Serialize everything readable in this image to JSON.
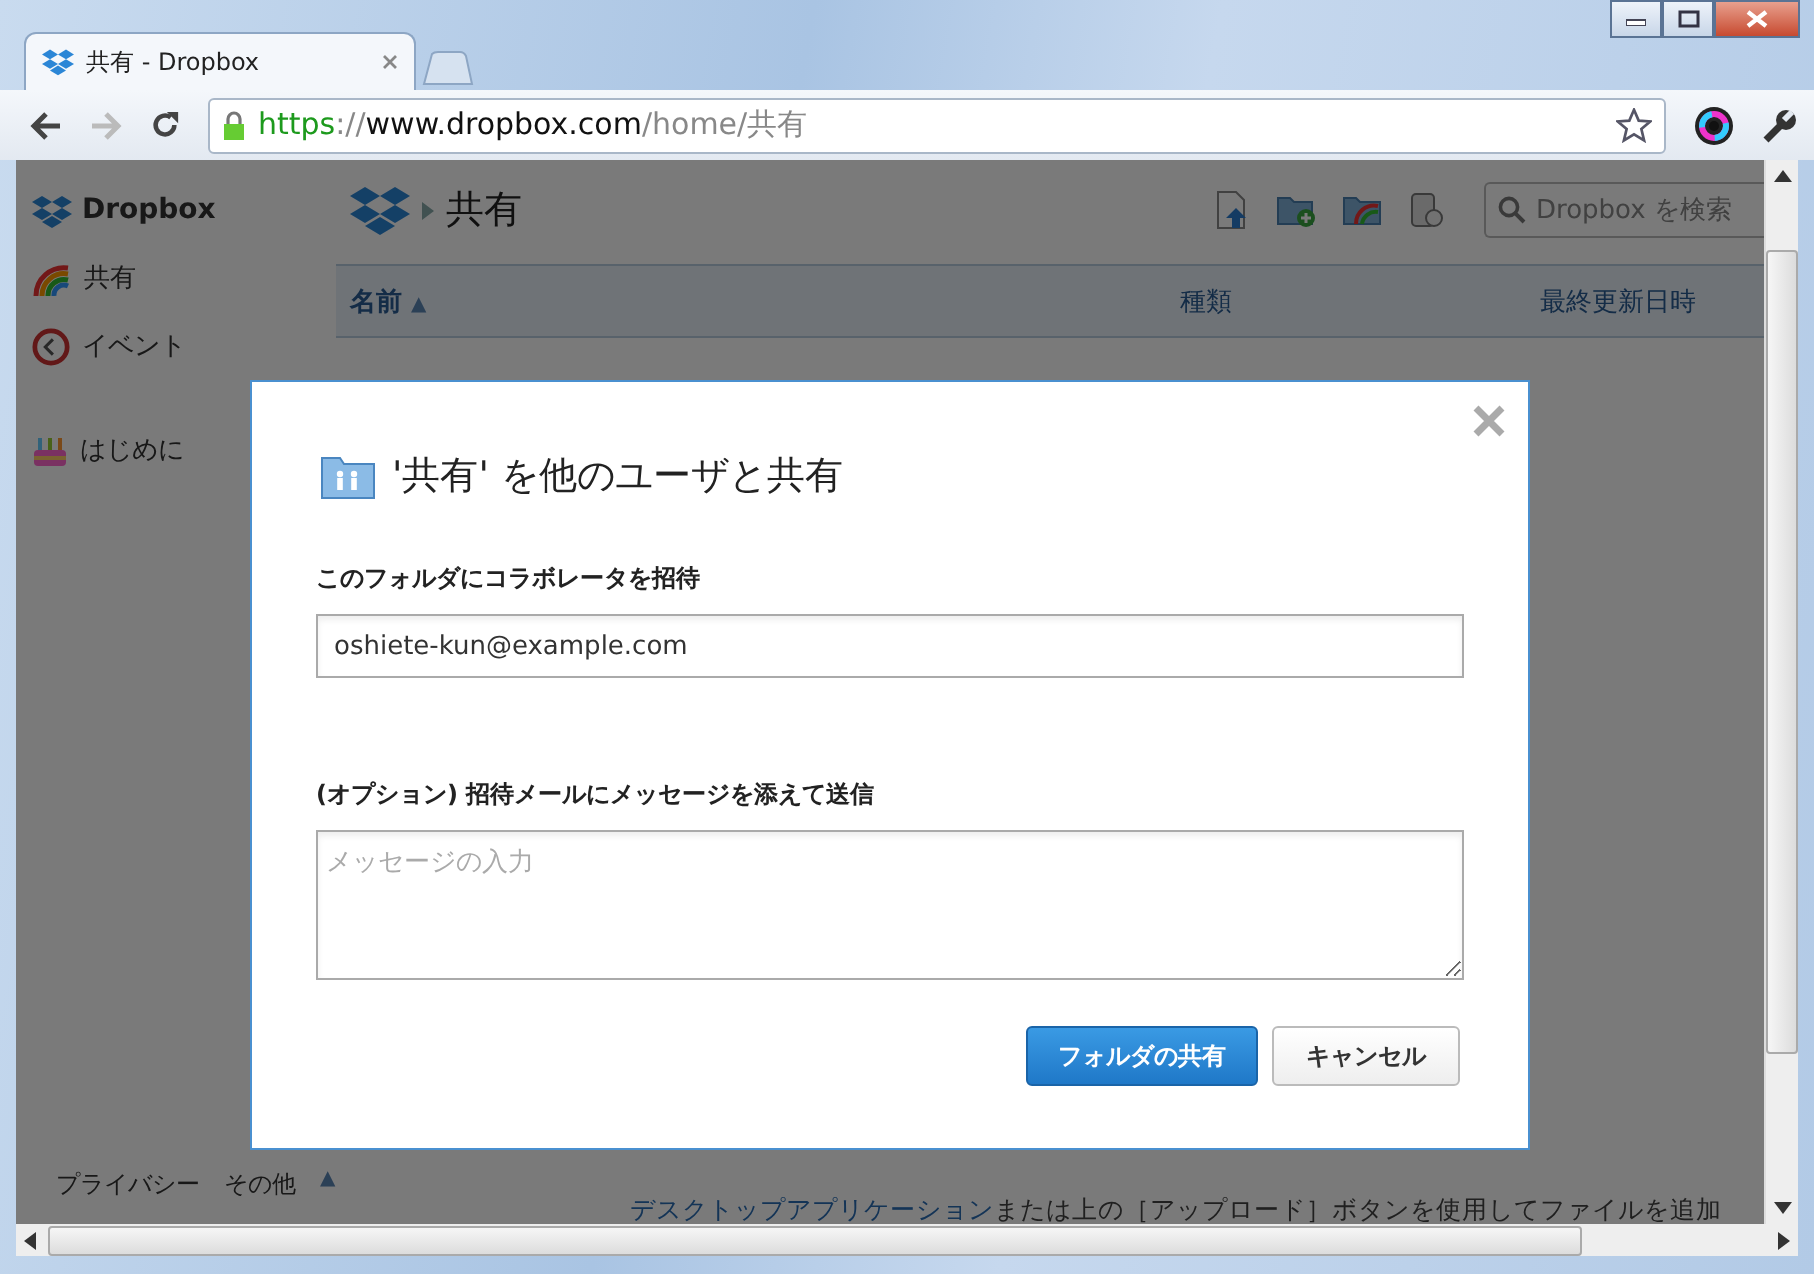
{
  "browser": {
    "tabs": [
      {
        "title": "共有 - Dropbox",
        "selected": true
      }
    ],
    "url": [
      {
        "text": "https",
        "kind": "scheme"
      },
      {
        "text": "://",
        "kind": "dim"
      },
      {
        "text": "www.dropbox.com",
        "kind": "host"
      },
      {
        "text": "/home/共有",
        "kind": "dim"
      }
    ]
  },
  "sidebar": {
    "brand": "Dropbox",
    "items": [
      {
        "label": "共有",
        "kind": "rainbow"
      },
      {
        "label": "イベント",
        "kind": "clock"
      },
      {
        "label": "はじめに",
        "kind": "cake"
      }
    ]
  },
  "header": {
    "breadcrumb": "共有",
    "search": {
      "placeholder": "Dropbox を検索"
    }
  },
  "table": {
    "columns": [
      {
        "label": "名前",
        "sort": "▲"
      },
      {
        "label": "種類"
      },
      {
        "label": "最終更新日時"
      }
    ]
  },
  "footer": {
    "links": [
      "プライバシー",
      "その他"
    ],
    "toggle": "▲"
  },
  "hint": {
    "link": "デスクトップアプリケーション",
    "text": "または上の［アップロード］ボタンを使用してファイルを追加"
  },
  "dialog": {
    "title": "'共有' を他のユーザと共有",
    "invite_label": "このフォルダにコラボレータを招待",
    "invite": {
      "value": "oshiete-kun@example.com"
    },
    "message_label": "(オプション) 招待メールにメッセージを添えて送信",
    "message": {
      "placeholder": "メッセージの入力"
    },
    "buttons": [
      {
        "label": "フォルダの共有",
        "kind": "primary"
      },
      {
        "label": "キャンセル",
        "kind": "secondary"
      }
    ]
  }
}
